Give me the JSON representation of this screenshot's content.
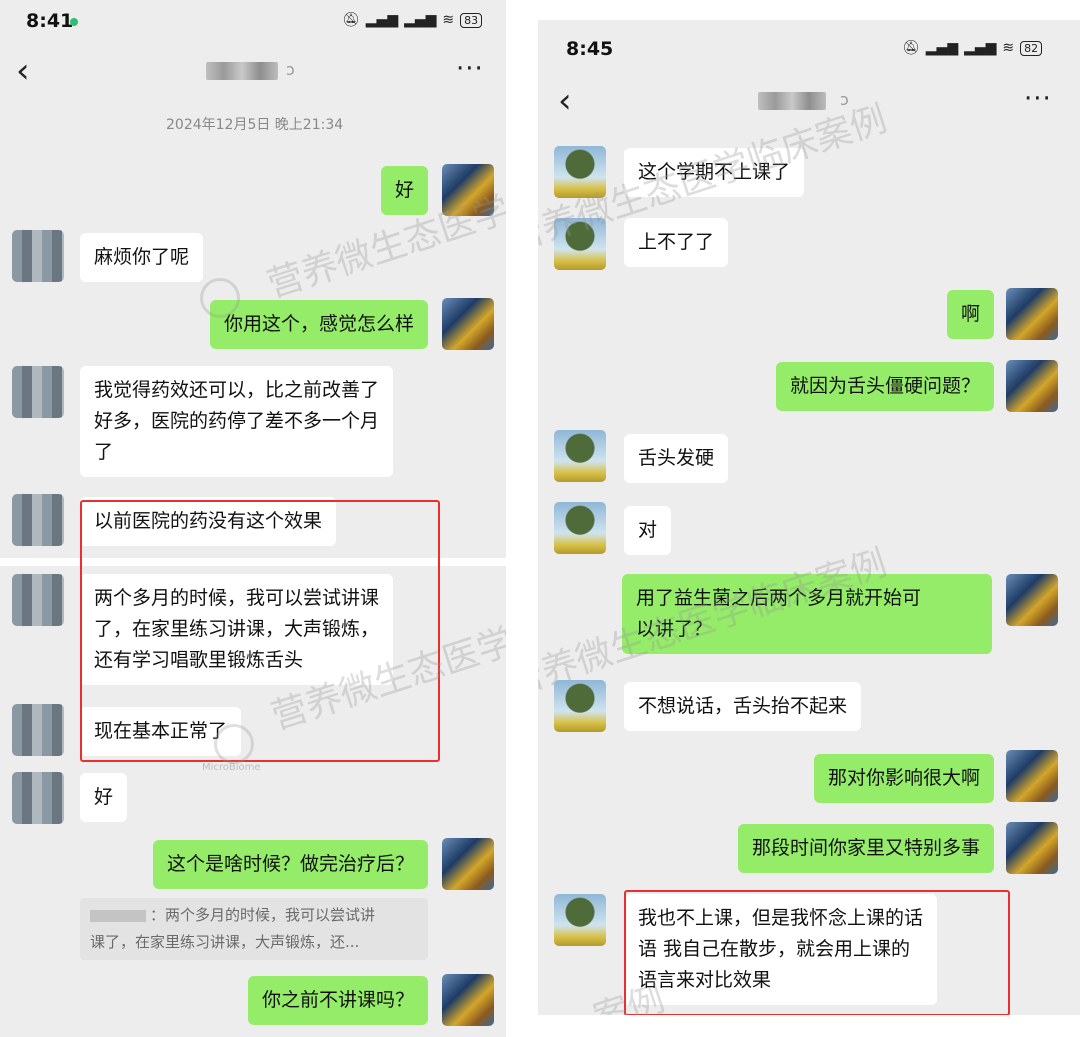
{
  "left": {
    "status": {
      "time": "8:41",
      "battery": "83",
      "signal": "HD signal wifi"
    },
    "header": {
      "back_icon": "‹",
      "more_icon": "···"
    },
    "date_separator": "2024年12月5日 晚上21:34",
    "messages": [
      {
        "side": "out",
        "text": "好"
      },
      {
        "side": "in",
        "text": "麻烦你了呢"
      },
      {
        "side": "out",
        "text": "你用这个，感觉怎么样"
      },
      {
        "side": "in",
        "lines": [
          "我觉得药效还可以，比之前改善了",
          "好多，医院的药停了差不多一个月",
          "了"
        ]
      },
      {
        "side": "in",
        "text": "以前医院的药没有这个效果"
      },
      {
        "side": "in",
        "lines": [
          "两个多月的时候，我可以尝试讲课",
          "了，在家里练习讲课，大声锻炼，",
          "还有学习唱歌里锻炼舌头"
        ]
      },
      {
        "side": "in",
        "text": "现在基本正常了"
      },
      {
        "side": "in",
        "text": "好"
      },
      {
        "side": "out",
        "text": "这个是啥时候？做完治疗后？"
      },
      {
        "side": "out",
        "text": "你之前不讲课吗？"
      }
    ],
    "quote_lines": [
      "：两个多月的时候，我可以尝试讲",
      "课了，在家里练习讲课，大声锻炼，还..."
    ]
  },
  "right": {
    "status": {
      "time": "8:45",
      "battery": "82",
      "signal": "HD signal wifi"
    },
    "header": {
      "back_icon": "‹",
      "more_icon": "···"
    },
    "messages": [
      {
        "side": "in",
        "text": "这个学期不上课了"
      },
      {
        "side": "in",
        "text": "上不了了"
      },
      {
        "side": "out",
        "text": "啊"
      },
      {
        "side": "out",
        "text": "就因为舌头僵硬问题？"
      },
      {
        "side": "in",
        "text": "舌头发硬"
      },
      {
        "side": "in",
        "text": "对"
      },
      {
        "side": "out",
        "lines": [
          "用了益生菌之后两个多月就开始可",
          "以讲了？"
        ]
      },
      {
        "side": "in",
        "text": "不想说话，舌头抬不起来"
      },
      {
        "side": "out",
        "text": "那对你影响很大啊"
      },
      {
        "side": "out",
        "text": "那段时间你家里又特别多事"
      },
      {
        "side": "in",
        "lines": [
          "我也不上课，但是我怀念上课的话",
          "语 我自己在散步，就会用上课的",
          "语言来对比效果"
        ]
      }
    ]
  },
  "watermark": {
    "text_left": "营养微生态医学临床案例",
    "text_right": "营养微生态医学临床案例",
    "text_bottom": "案例",
    "logo_caption": "MicroBiome"
  },
  "colors": {
    "outgoing_bubble": "#95ec69",
    "incoming_bubble": "#ffffff",
    "chat_background": "#ededed",
    "highlight_box": "#e8312f"
  }
}
